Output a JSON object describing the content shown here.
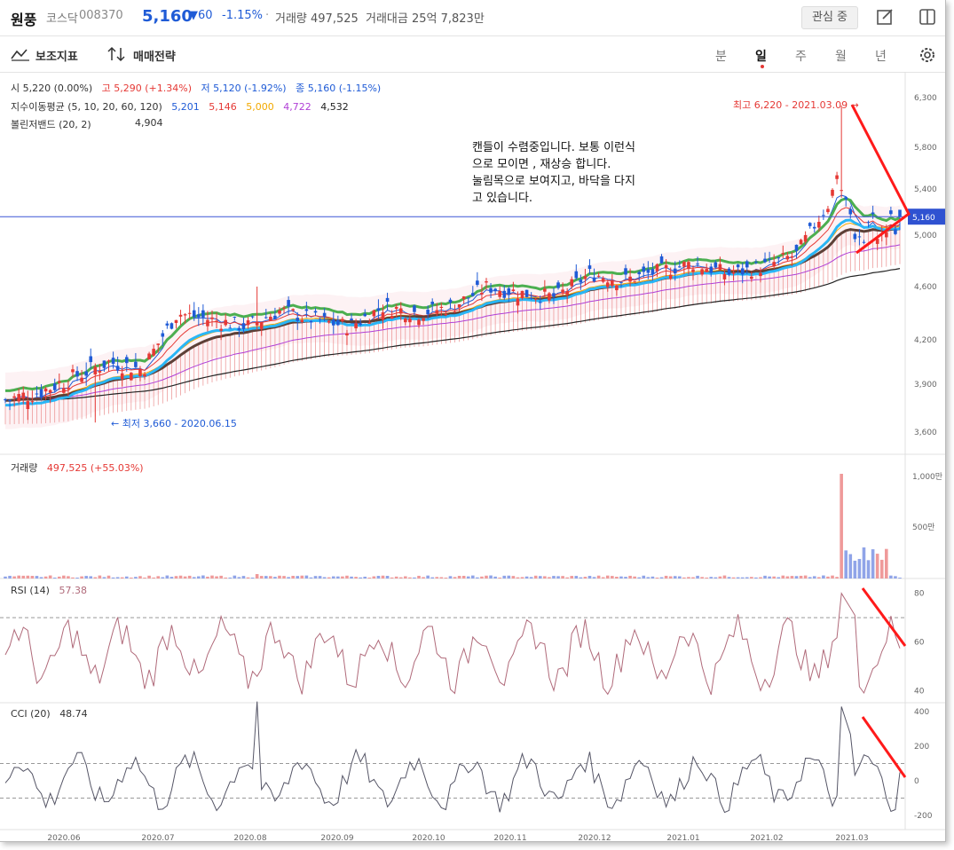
{
  "header": {
    "name": "원풍",
    "market": "코스닥",
    "code": "008370",
    "price": "5,160",
    "change": "▼60",
    "rate": "-1.15%",
    "dot": "·",
    "volume": "거래량 497,525",
    "amount": "거래대금 25억 7,823만",
    "fav_label": "관심 중"
  },
  "toolbar": {
    "indicators_label": "보조지표",
    "strategy_label": "매매전략",
    "periods": [
      "분",
      "일",
      "주",
      "월",
      "년"
    ],
    "active_period": "일"
  },
  "legend": {
    "ohlc": [
      "시 5,220 (0.00%)",
      "고 5,290 (+1.34%)",
      "저 5,120 (-1.92%)",
      "종 5,160 (-1.15%)"
    ],
    "ma_title": "지수이동평균 (5, 10, 20, 60, 120)",
    "ma_values": [
      "5,201",
      "5,146",
      "5,000",
      "4,722",
      "4,532"
    ],
    "bb_title": "볼린저밴드 (20, 2)",
    "bb_value": "4,904",
    "volume_title": "거래량",
    "volume_value": "497,525 (+55.03%)",
    "rsi_title": "RSI (14)",
    "rsi_value": "57.38",
    "cci_title": "CCI (20)",
    "cci_value": "48.74"
  },
  "annotation": {
    "high_label": "최고 6,220 - 2021.03.09 →",
    "low_label": "← 최저 3,660 - 2020.06.15",
    "note": [
      "캔들이 수렴중입니다. 보통 이런식",
      "으로 모이면 , 재상승 합니다.",
      "눌림목으로 보여지고, 바닥을 다지",
      "고 있습니다."
    ]
  },
  "colors": {
    "up": "#e53935",
    "down": "#1f5bd6",
    "ma5": "#1f5bd6",
    "ma10": "#e53935",
    "ma20": "#f2a900",
    "ma60": "#b03fd6",
    "ma120": "#222222",
    "bb": "#4caf50",
    "rsi": "#b06a7a",
    "cci": "#555566",
    "trend": "#ff1a1a"
  },
  "chart_data": {
    "type": "candlestick",
    "x_ticks": [
      "2020.06",
      "2020.07",
      "2020.08",
      "2020.09",
      "2020.10",
      "2020.11",
      "2020.12",
      "2021.01",
      "2021.02",
      "2021.03"
    ],
    "price_ticks": [
      3600,
      3900,
      4200,
      4600,
      5000,
      5400,
      5800,
      6300
    ],
    "price_tick_labels": [
      "3,600",
      "3,900",
      "4,200",
      "4,600",
      "5,000",
      "5,400",
      "5,800",
      "6,300"
    ],
    "current_price": 5160,
    "current_price_label": "5,160",
    "close_approx": [
      3800,
      3850,
      3950,
      4050,
      4000,
      4400,
      4350,
      4300,
      4420,
      4350,
      4300,
      4450,
      4400,
      4450,
      4600,
      4550,
      4520,
      4700,
      4650,
      4720,
      4780,
      4700,
      4750,
      4850,
      5300,
      5200,
      5160
    ],
    "volume_ticks_labels": [
      "1,000만",
      "500만"
    ],
    "volume_peak": 9500000,
    "rsi_ticks": [
      40,
      60,
      80
    ],
    "rsi_last": 57.38,
    "cci_ticks": [
      -200,
      0,
      200,
      400
    ],
    "cci_last": 48.74
  }
}
